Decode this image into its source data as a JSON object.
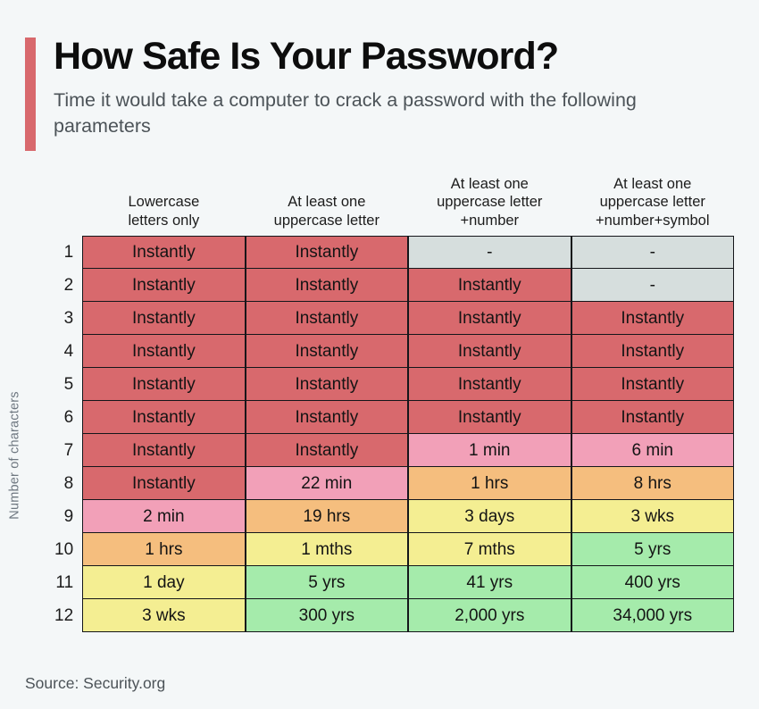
{
  "header": {
    "title": "How Safe Is Your Password?",
    "subtitle": "Time it would take a computer to crack a password with the following parameters",
    "accent_color": "#d8696d"
  },
  "axis": {
    "y_label": "Number of characters"
  },
  "footer": {
    "source": "Source: Security.org"
  },
  "legend_colors": {
    "instant_red": "#d8696d",
    "pink": "#f2a0b8",
    "orange": "#f5be7e",
    "yellow": "#f4ee92",
    "green": "#a5ebab",
    "gray_na": "#d6dedd"
  },
  "chart_data": {
    "type": "heatmap",
    "title": "How Safe Is Your Password?",
    "subtitle": "Time it would take a computer to crack a password with the following parameters",
    "xlabel": "",
    "ylabel": "Number of characters",
    "grid": true,
    "legend": "none",
    "categories": [
      "Lowercase letters only",
      "At least one uppercase letter",
      "At least one uppercase letter +number",
      "At least one uppercase letter +number+symbol"
    ],
    "column_headers": [
      [
        "Lowercase",
        "letters only"
      ],
      [
        "At least one",
        "uppercase letter"
      ],
      [
        "At least one",
        "uppercase letter",
        "+number"
      ],
      [
        "At least one",
        "uppercase letter",
        "+number+symbol"
      ]
    ],
    "row_labels": [
      "1",
      "2",
      "3",
      "4",
      "5",
      "6",
      "7",
      "8",
      "9",
      "10",
      "11",
      "12"
    ],
    "rows": [
      {
        "n": "1",
        "cells": [
          {
            "value": "Instantly",
            "color": "#d8696d"
          },
          {
            "value": "Instantly",
            "color": "#d8696d"
          },
          {
            "value": "-",
            "color": "#d6dedd"
          },
          {
            "value": "-",
            "color": "#d6dedd"
          }
        ]
      },
      {
        "n": "2",
        "cells": [
          {
            "value": "Instantly",
            "color": "#d8696d"
          },
          {
            "value": "Instantly",
            "color": "#d8696d"
          },
          {
            "value": "Instantly",
            "color": "#d8696d"
          },
          {
            "value": "-",
            "color": "#d6dedd"
          }
        ]
      },
      {
        "n": "3",
        "cells": [
          {
            "value": "Instantly",
            "color": "#d8696d"
          },
          {
            "value": "Instantly",
            "color": "#d8696d"
          },
          {
            "value": "Instantly",
            "color": "#d8696d"
          },
          {
            "value": "Instantly",
            "color": "#d8696d"
          }
        ]
      },
      {
        "n": "4",
        "cells": [
          {
            "value": "Instantly",
            "color": "#d8696d"
          },
          {
            "value": "Instantly",
            "color": "#d8696d"
          },
          {
            "value": "Instantly",
            "color": "#d8696d"
          },
          {
            "value": "Instantly",
            "color": "#d8696d"
          }
        ]
      },
      {
        "n": "5",
        "cells": [
          {
            "value": "Instantly",
            "color": "#d8696d"
          },
          {
            "value": "Instantly",
            "color": "#d8696d"
          },
          {
            "value": "Instantly",
            "color": "#d8696d"
          },
          {
            "value": "Instantly",
            "color": "#d8696d"
          }
        ]
      },
      {
        "n": "6",
        "cells": [
          {
            "value": "Instantly",
            "color": "#d8696d"
          },
          {
            "value": "Instantly",
            "color": "#d8696d"
          },
          {
            "value": "Instantly",
            "color": "#d8696d"
          },
          {
            "value": "Instantly",
            "color": "#d8696d"
          }
        ]
      },
      {
        "n": "7",
        "cells": [
          {
            "value": "Instantly",
            "color": "#d8696d"
          },
          {
            "value": "Instantly",
            "color": "#d8696d"
          },
          {
            "value": "1 min",
            "color": "#f2a0b8"
          },
          {
            "value": "6 min",
            "color": "#f2a0b8"
          }
        ]
      },
      {
        "n": "8",
        "cells": [
          {
            "value": "Instantly",
            "color": "#d8696d"
          },
          {
            "value": "22 min",
            "color": "#f2a0b8"
          },
          {
            "value": "1 hrs",
            "color": "#f5be7e"
          },
          {
            "value": "8 hrs",
            "color": "#f5be7e"
          }
        ]
      },
      {
        "n": "9",
        "cells": [
          {
            "value": "2 min",
            "color": "#f2a0b8"
          },
          {
            "value": "19 hrs",
            "color": "#f5be7e"
          },
          {
            "value": "3 days",
            "color": "#f4ee92"
          },
          {
            "value": "3 wks",
            "color": "#f4ee92"
          }
        ]
      },
      {
        "n": "10",
        "cells": [
          {
            "value": "1 hrs",
            "color": "#f5be7e"
          },
          {
            "value": "1 mths",
            "color": "#f4ee92"
          },
          {
            "value": "7 mths",
            "color": "#f4ee92"
          },
          {
            "value": "5 yrs",
            "color": "#a5ebab"
          }
        ]
      },
      {
        "n": "11",
        "cells": [
          {
            "value": "1 day",
            "color": "#f4ee92"
          },
          {
            "value": "5 yrs",
            "color": "#a5ebab"
          },
          {
            "value": "41 yrs",
            "color": "#a5ebab"
          },
          {
            "value": "400 yrs",
            "color": "#a5ebab"
          }
        ]
      },
      {
        "n": "12",
        "cells": [
          {
            "value": "3 wks",
            "color": "#f4ee92"
          },
          {
            "value": "300 yrs",
            "color": "#a5ebab"
          },
          {
            "value": "2,000 yrs",
            "color": "#a5ebab"
          },
          {
            "value": "34,000 yrs",
            "color": "#a5ebab"
          }
        ]
      }
    ]
  }
}
